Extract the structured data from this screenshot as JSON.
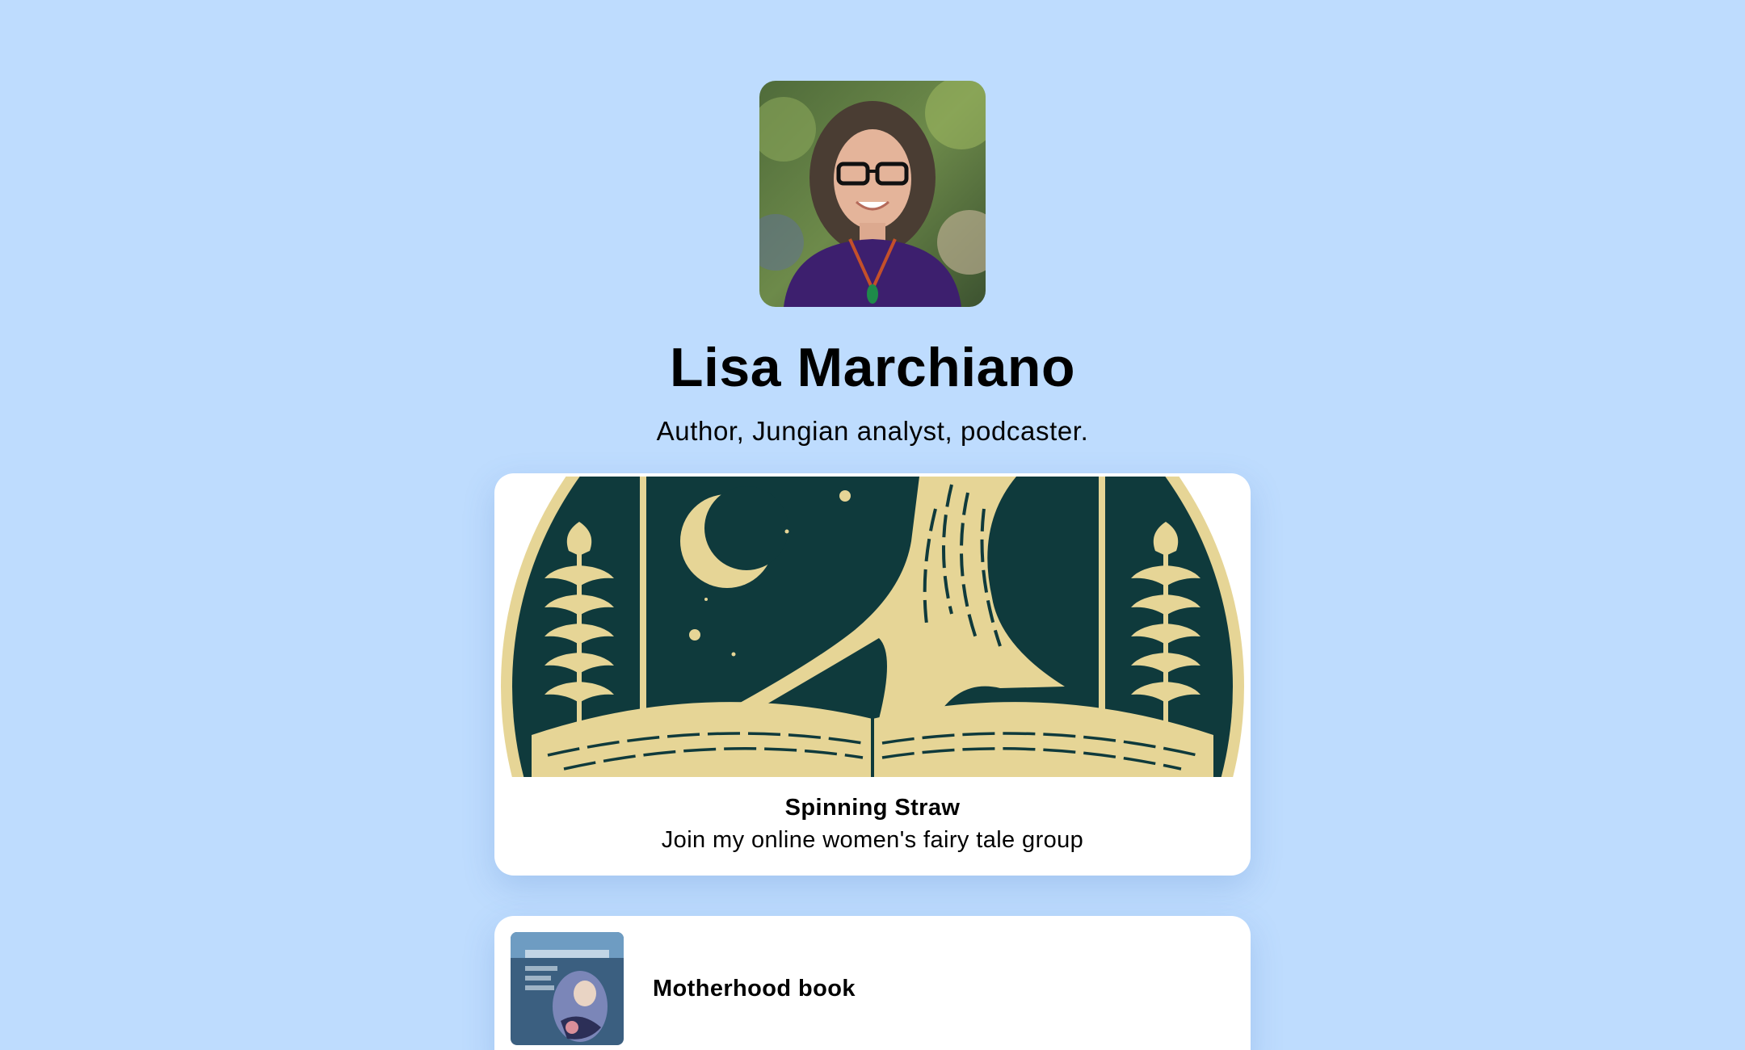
{
  "profile": {
    "name": "Lisa Marchiano",
    "bio": "Author, Jungian analyst, podcaster."
  },
  "links": {
    "featured": {
      "title": "Spinning Straw",
      "subtitle": "Join my online women's fairy tale group",
      "image_icon": "tree-on-open-book-icon"
    },
    "items": [
      {
        "title": "Motherhood book",
        "image_icon": "book-cover-icon"
      }
    ]
  },
  "colors": {
    "background": "#bedcfe",
    "card": "#ffffff",
    "night_sky": "#0f3a3c",
    "gold": "#e6d596",
    "text": "#000000"
  }
}
